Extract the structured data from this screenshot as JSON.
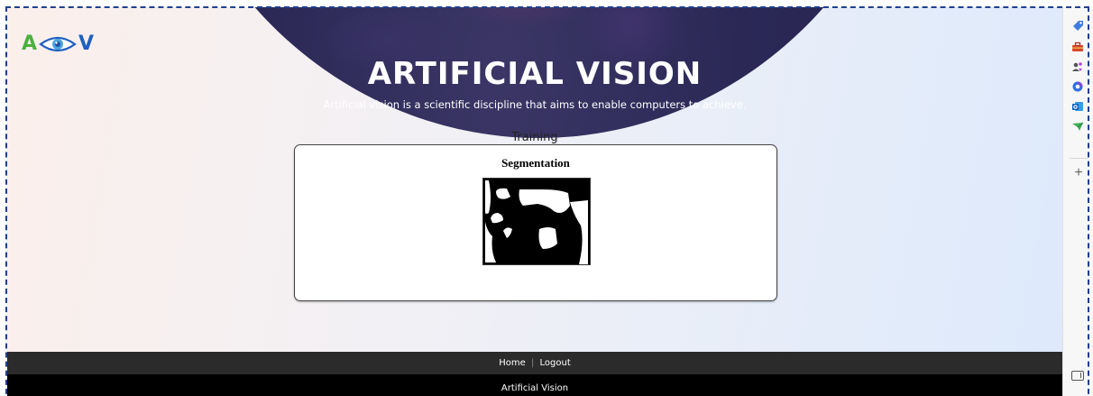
{
  "logo": {
    "letter_left": "A",
    "letter_right": "V",
    "eye_icon": "eye-icon"
  },
  "hero": {
    "title": "ARTIFICIAL VISION",
    "subtitle": "Artificial vision is a scientific discipline that aims to enable computers to achieve."
  },
  "section": {
    "label": "Training"
  },
  "card": {
    "title": "Segmentation",
    "image_icon": "segmentation-mask-image"
  },
  "footer": {
    "nav": {
      "home": "Home",
      "separator": "|",
      "logout": "Logout"
    },
    "brand": "Artificial Vision"
  },
  "sidebar": {
    "icons": [
      "tag-icon",
      "toolbox-icon",
      "people-icon",
      "copilot-icon",
      "outlook-icon",
      "send-icon",
      "add-icon",
      "sidebar-panel-icon"
    ]
  },
  "colors": {
    "hero_bg": "#2b2856",
    "logo_green": "#4caf3f",
    "logo_blue": "#1f5fbf",
    "footer_nav_bg": "#2b2b2b",
    "footer_brand_bg": "#000000",
    "frame_dash": "#1f3f8f"
  }
}
